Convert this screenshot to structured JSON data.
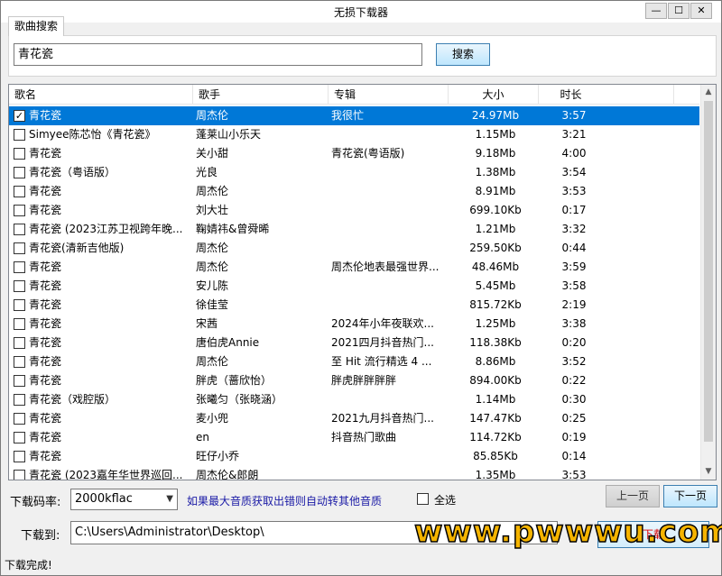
{
  "window": {
    "title": "无损下载器",
    "min": "—",
    "max": "☐",
    "close": "✕"
  },
  "tabs": [
    {
      "label": "歌曲搜索"
    }
  ],
  "search": {
    "value": "青花瓷",
    "button": "搜索"
  },
  "table": {
    "headers": [
      "歌名",
      "歌手",
      "专辑",
      "大小",
      "时长"
    ],
    "rows": [
      {
        "checked": true,
        "title": "青花瓷",
        "artist": "周杰伦",
        "album": "我很忙",
        "size": "24.97Mb",
        "duration": "3:57"
      },
      {
        "checked": false,
        "title": "Simyee陈芯怡《青花瓷》",
        "artist": "蓬莱山小乐天",
        "album": "",
        "size": "1.15Mb",
        "duration": "3:21"
      },
      {
        "checked": false,
        "title": "青花瓷",
        "artist": "关小甜",
        "album": "青花瓷(粤语版)",
        "size": "9.18Mb",
        "duration": "4:00"
      },
      {
        "checked": false,
        "title": "青花瓷（粤语版）",
        "artist": "光良",
        "album": "",
        "size": "1.38Mb",
        "duration": "3:54"
      },
      {
        "checked": false,
        "title": "青花瓷",
        "artist": "周杰伦",
        "album": "",
        "size": "8.91Mb",
        "duration": "3:53"
      },
      {
        "checked": false,
        "title": "青花瓷",
        "artist": "刘大壮",
        "album": "",
        "size": "699.10Kb",
        "duration": "0:17"
      },
      {
        "checked": false,
        "title": "青花瓷 (2023江苏卫视跨年晚...",
        "artist": "鞠婧祎&曾舜晞",
        "album": "",
        "size": "1.21Mb",
        "duration": "3:32"
      },
      {
        "checked": false,
        "title": "青花瓷(清新吉他版)",
        "artist": "周杰伦",
        "album": "",
        "size": "259.50Kb",
        "duration": "0:44"
      },
      {
        "checked": false,
        "title": "青花瓷",
        "artist": "周杰伦",
        "album": "周杰伦地表最强世界...",
        "size": "48.46Mb",
        "duration": "3:59"
      },
      {
        "checked": false,
        "title": "青花瓷",
        "artist": "安儿陈",
        "album": "",
        "size": "5.45Mb",
        "duration": "3:58"
      },
      {
        "checked": false,
        "title": "青花瓷",
        "artist": "徐佳莹",
        "album": "",
        "size": "815.72Kb",
        "duration": "2:19"
      },
      {
        "checked": false,
        "title": "青花瓷",
        "artist": "宋茜",
        "album": "2024年小年夜联欢...",
        "size": "1.25Mb",
        "duration": "3:38"
      },
      {
        "checked": false,
        "title": "青花瓷",
        "artist": "唐伯虎Annie",
        "album": "2021四月抖音热门...",
        "size": "118.38Kb",
        "duration": "0:20"
      },
      {
        "checked": false,
        "title": "青花瓷",
        "artist": "周杰伦",
        "album": "至 Hit 流行精选 4 ...",
        "size": "8.86Mb",
        "duration": "3:52"
      },
      {
        "checked": false,
        "title": "青花瓷",
        "artist": "胖虎（蔷欣怡）",
        "album": "胖虎胖胖胖胖",
        "size": "894.00Kb",
        "duration": "0:22"
      },
      {
        "checked": false,
        "title": "青花瓷（戏腔版）",
        "artist": "张曦匀（张晓涵）",
        "album": "",
        "size": "1.14Mb",
        "duration": "0:30"
      },
      {
        "checked": false,
        "title": "青花瓷",
        "artist": "麦小兜",
        "album": "2021九月抖音热门...",
        "size": "147.47Kb",
        "duration": "0:25"
      },
      {
        "checked": false,
        "title": "青花瓷",
        "artist": "en",
        "album": "抖音热门歌曲",
        "size": "114.72Kb",
        "duration": "0:19"
      },
      {
        "checked": false,
        "title": "青花瓷",
        "artist": "旺仔小乔",
        "album": "",
        "size": "85.85Kb",
        "duration": "0:14"
      },
      {
        "checked": false,
        "title": "青花瓷 (2023嘉年华世界巡回...",
        "artist": "周杰伦&郎朗",
        "album": "",
        "size": "1.35Mb",
        "duration": "3:53"
      }
    ]
  },
  "controls": {
    "rate_label": "下载码率:",
    "rate_value": "2000kflac",
    "hint": "如果最大音质获取出错则自动转其他音质",
    "select_all": "全选",
    "prev": "上一页",
    "next": "下一页",
    "dest_label": "下载到:",
    "dest_path": "C:\\Users\\Administrator\\Desktop\\",
    "download": "下载"
  },
  "watermark": "www.pwwwu.com",
  "status": "下载完成!"
}
